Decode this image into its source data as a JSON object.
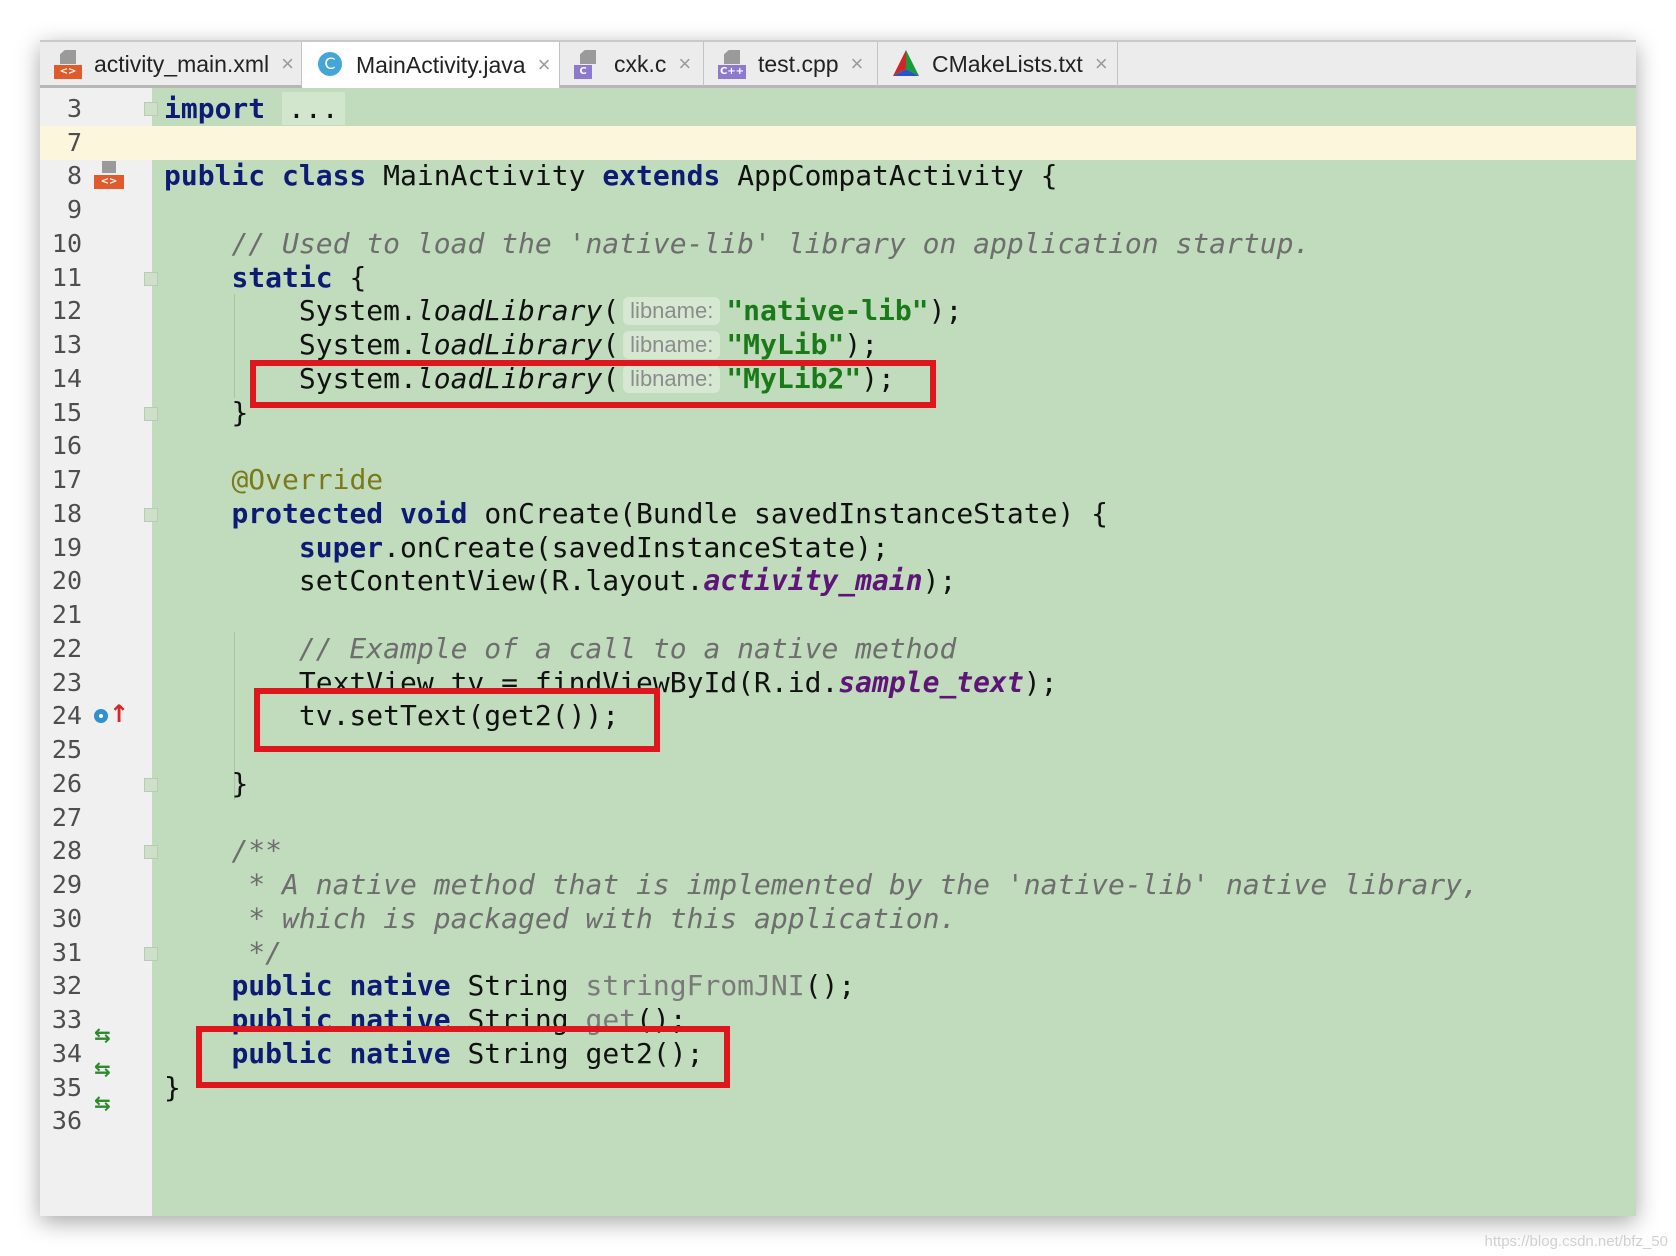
{
  "tabs": [
    {
      "label": "activity_main.xml",
      "icon": "xml-layout-file-icon",
      "badge": "<>"
    },
    {
      "label": "MainActivity.java",
      "icon": "java-class-icon",
      "badge": "C",
      "active": true
    },
    {
      "label": "cxk.c",
      "icon": "c-file-icon",
      "badge": "C"
    },
    {
      "label": "test.cpp",
      "icon": "cpp-file-icon",
      "badge": "C++"
    },
    {
      "label": "CMakeLists.txt",
      "icon": "cmake-icon",
      "badge": ""
    }
  ],
  "close_glyph": "×",
  "line_numbers": [
    "3",
    "7",
    "8",
    "9",
    "10",
    "11",
    "12",
    "13",
    "14",
    "15",
    "16",
    "17",
    "18",
    "19",
    "20",
    "21",
    "22",
    "23",
    "24",
    "25",
    "26",
    "27",
    "28",
    "29",
    "30",
    "31",
    "32",
    "33",
    "34",
    "35",
    "36"
  ],
  "code": {
    "l3_kw": "import",
    "l3_dots": "...",
    "l8_kw": "public class",
    "l8_name": "MainActivity",
    "l8_ext": "extends",
    "l8_rest": "AppCompatActivity {",
    "l10": "// Used to load the 'native-lib' library on application startup.",
    "l11_kw": "static",
    "l11_rest": "{",
    "sys": "System.",
    "load": "loadLibrary",
    "paren": "(",
    "hint": "libname:",
    "l12_str": "\"native-lib\"",
    "l13_str": "\"MyLib\"",
    "l14_str": "\"MyLib2\"",
    "end": ");",
    "l15": "}",
    "l17": "@Override",
    "l18_kw": "protected void",
    "l18_rest": "onCreate(Bundle savedInstanceState) {",
    "l19_kw": "super",
    "l19_rest": ".onCreate(savedInstanceState);",
    "l20_a": "setContentView(R.layout.",
    "l20_f": "activity_main",
    "l20_b": ");",
    "l22": "// Example of a call to a native method",
    "l23_a": "TextView tv = findViewById(R.id.",
    "l23_f": "sample_text",
    "l23_b": ");",
    "l24": "tv.setText(get2());",
    "l26": "}",
    "l28": "/**",
    "l29": " * A native method that is implemented by the 'native-lib' native library,",
    "l30": " * which is packaged with this application.",
    "l31": " */",
    "pn": "public native",
    "str_t": "String",
    "l32_m": "stringFromJNI",
    "l32_e": "();",
    "l33_m": "get",
    "l33_e": "();",
    "l34_m": "get2();",
    "l35": "}"
  },
  "gutter_markers": {
    "implements_glyph": "⇆",
    "override_glyph": "↑"
  },
  "watermark": "https://blog.csdn.net/bfz_50",
  "colors": {
    "editor_bg": "#c0dcbc",
    "highlight_line": "#fcf7dc",
    "keyword": "#0e1b74",
    "string": "#1a7a17",
    "annotation_box": "#e0161e"
  }
}
